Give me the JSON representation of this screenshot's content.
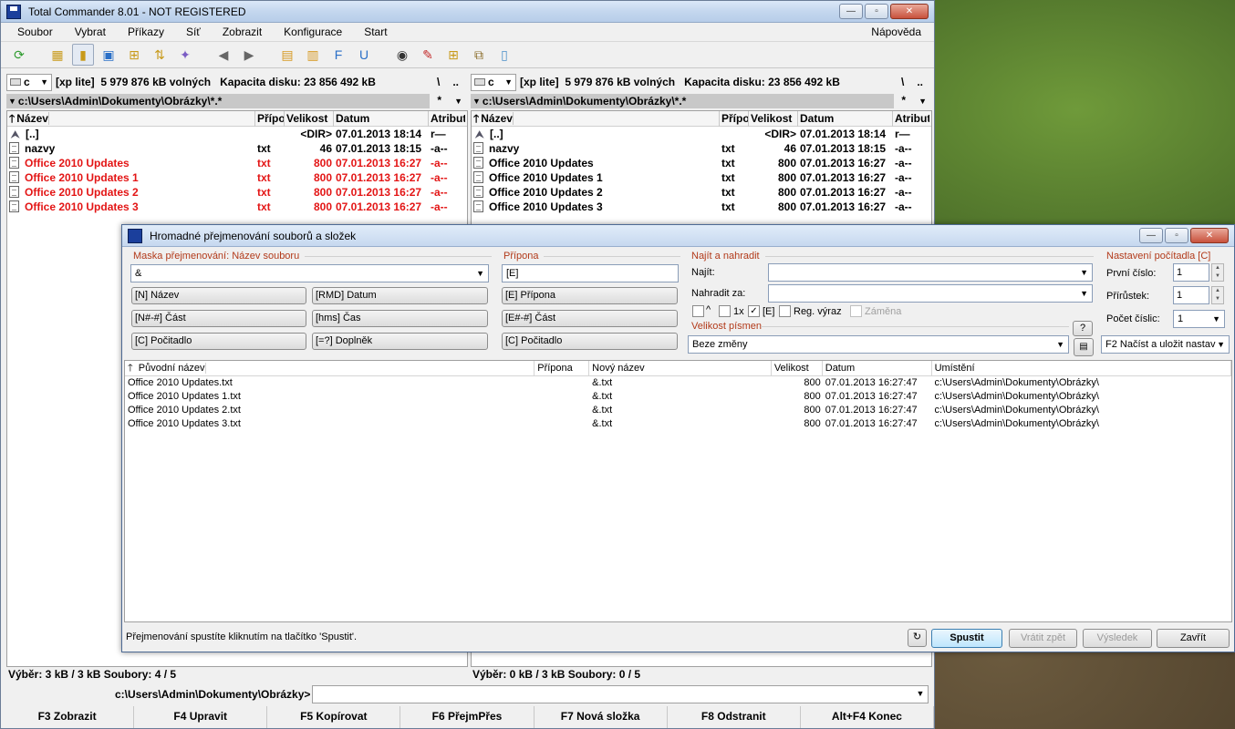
{
  "window": {
    "title": "Total Commander 8.01 - NOT REGISTERED"
  },
  "menu": [
    "Soubor",
    "Vybrat",
    "Příkazy",
    "Síť",
    "Zobrazit",
    "Konfigurace",
    "Start"
  ],
  "menu_help": "Nápověda",
  "toolbar_icons": [
    "refresh-icon",
    "brief-view-icon",
    "full-view-icon",
    "thumbnail-view-icon",
    "tree-view-icon",
    "sort-icon",
    "invert-selection-icon",
    "back-icon",
    "forward-icon",
    "pack-icon",
    "unpack-icon",
    "ftp-icon",
    "url-icon",
    "find-icon",
    "multi-rename-icon",
    "sync-dirs-icon",
    "compare-icon",
    "notepad-icon"
  ],
  "left_panel": {
    "drive": "c",
    "drive_label": "[xp lite]",
    "free": "5 979 876 kB volných",
    "capacity": "Kapacita disku: 23 856 492 kB",
    "path": "c:\\Users\\Admin\\Dokumenty\\Obrázky\\*.*",
    "columns": {
      "name": "Název",
      "ext": "Přípo",
      "size": "Velikost",
      "date": "Datum",
      "attr": "Atribut"
    },
    "rows": [
      {
        "name": "[..]",
        "ext": "",
        "size": "<DIR>",
        "date": "07.01.2013 18:14",
        "attr": "r—",
        "up": true,
        "selected": false
      },
      {
        "name": "nazvy",
        "ext": "txt",
        "size": "46",
        "date": "07.01.2013 18:15",
        "attr": "-a--",
        "up": false,
        "selected": false
      },
      {
        "name": "Office 2010 Updates",
        "ext": "txt",
        "size": "800",
        "date": "07.01.2013 16:27",
        "attr": "-a--",
        "up": false,
        "selected": true
      },
      {
        "name": "Office 2010 Updates 1",
        "ext": "txt",
        "size": "800",
        "date": "07.01.2013 16:27",
        "attr": "-a--",
        "up": false,
        "selected": true
      },
      {
        "name": "Office 2010 Updates 2",
        "ext": "txt",
        "size": "800",
        "date": "07.01.2013 16:27",
        "attr": "-a--",
        "up": false,
        "selected": true
      },
      {
        "name": "Office 2010 Updates 3",
        "ext": "txt",
        "size": "800",
        "date": "07.01.2013 16:27",
        "attr": "-a--",
        "up": false,
        "selected": true
      }
    ],
    "status": "Výběr: 3 kB / 3 kB   Soubory: 4 / 5"
  },
  "right_panel": {
    "drive": "c",
    "drive_label": "[xp lite]",
    "free": "5 979 876 kB volných",
    "capacity": "Kapacita disku: 23 856 492 kB",
    "path": "c:\\Users\\Admin\\Dokumenty\\Obrázky\\*.*",
    "columns": {
      "name": "Název",
      "ext": "Přípo",
      "size": "Velikost",
      "date": "Datum",
      "attr": "Atribut"
    },
    "rows": [
      {
        "name": "[..]",
        "ext": "",
        "size": "<DIR>",
        "date": "07.01.2013 18:14",
        "attr": "r—",
        "up": true,
        "selected": false
      },
      {
        "name": "nazvy",
        "ext": "txt",
        "size": "46",
        "date": "07.01.2013 18:15",
        "attr": "-a--",
        "up": false,
        "selected": false
      },
      {
        "name": "Office 2010 Updates",
        "ext": "txt",
        "size": "800",
        "date": "07.01.2013 16:27",
        "attr": "-a--",
        "up": false,
        "selected": false
      },
      {
        "name": "Office 2010 Updates 1",
        "ext": "txt",
        "size": "800",
        "date": "07.01.2013 16:27",
        "attr": "-a--",
        "up": false,
        "selected": false
      },
      {
        "name": "Office 2010 Updates 2",
        "ext": "txt",
        "size": "800",
        "date": "07.01.2013 16:27",
        "attr": "-a--",
        "up": false,
        "selected": false
      },
      {
        "name": "Office 2010 Updates 3",
        "ext": "txt",
        "size": "800",
        "date": "07.01.2013 16:27",
        "attr": "-a--",
        "up": false,
        "selected": false
      }
    ],
    "status": "Výběr: 0 kB / 3 kB   Soubory: 0 / 5"
  },
  "panel_tools": {
    "root": "\\",
    "parent": "..",
    "filter": "*",
    "history": "▼"
  },
  "cmdline": {
    "prompt": "c:\\Users\\Admin\\Dokumenty\\Obrázky>",
    "value": ""
  },
  "fkeys": [
    "F3 Zobrazit",
    "F4 Upravit",
    "F5 Kopírovat",
    "F6 PřejmPřes",
    "F7 Nová složka",
    "F8 Odstranit",
    "Alt+F4 Konec"
  ],
  "dialog": {
    "title": "Hromadné přejmenování souborů a složek",
    "mask_label": "Maska přejmenování: Název souboru",
    "mask_value": "&",
    "mask_buttons": [
      "[N] Název",
      "[RMD] Datum",
      "[N#-#] Část",
      "[hms] Čas",
      "[C] Počitadlo",
      "[=?] Doplněk"
    ],
    "ext_label": "Přípona",
    "ext_value": "[E]",
    "ext_buttons": [
      "[E] Přípona",
      "[E#-#] Část",
      "[C] Počitadlo"
    ],
    "find_label": "Najít a nahradit",
    "find_field_label": "Najít:",
    "find_value": "",
    "replace_field_label": "Nahradit za:",
    "replace_value": "",
    "opt_caret": "^",
    "opt_1x": "1x",
    "opt_e": "[E]",
    "opt_regex": "Reg. výraz",
    "opt_subst": "Záměna",
    "case_label": "Velikost písmen",
    "case_value": "Beze změny",
    "help_btn": "?",
    "counter_label": "Nastavení počítadla [C]",
    "counter_start_label": "První číslo:",
    "counter_start": "1",
    "counter_step_label": "Přírůstek:",
    "counter_step": "1",
    "counter_digits_label": "Počet číslic:",
    "counter_digits": "1",
    "load_save": "F2 Načíst a uložit nastav",
    "preview_cols": {
      "orig": "Původní název",
      "ext": "Přípona",
      "new": "Nový název",
      "size": "Velikost",
      "date": "Datum",
      "loc": "Umístění"
    },
    "preview_rows": [
      {
        "orig": "Office 2010 Updates.txt",
        "ext": "",
        "new": "&.txt",
        "size": "800",
        "date": "07.01.2013 16:27:47",
        "loc": "c:\\Users\\Admin\\Dokumenty\\Obrázky\\"
      },
      {
        "orig": "Office 2010 Updates 1.txt",
        "ext": "",
        "new": "&.txt",
        "size": "800",
        "date": "07.01.2013 16:27:47",
        "loc": "c:\\Users\\Admin\\Dokumenty\\Obrázky\\"
      },
      {
        "orig": "Office 2010 Updates 2.txt",
        "ext": "",
        "new": "&.txt",
        "size": "800",
        "date": "07.01.2013 16:27:47",
        "loc": "c:\\Users\\Admin\\Dokumenty\\Obrázky\\"
      },
      {
        "orig": "Office 2010 Updates 3.txt",
        "ext": "",
        "new": "&.txt",
        "size": "800",
        "date": "07.01.2013 16:27:47",
        "loc": "c:\\Users\\Admin\\Dokumenty\\Obrázky\\"
      }
    ],
    "status_text": "Přejmenování spustíte kliknutím na tlačítko 'Spustit'.",
    "btn_start": "Spustit",
    "btn_undo": "Vrátit zpět",
    "btn_result": "Výsledek",
    "btn_close": "Zavřít"
  }
}
